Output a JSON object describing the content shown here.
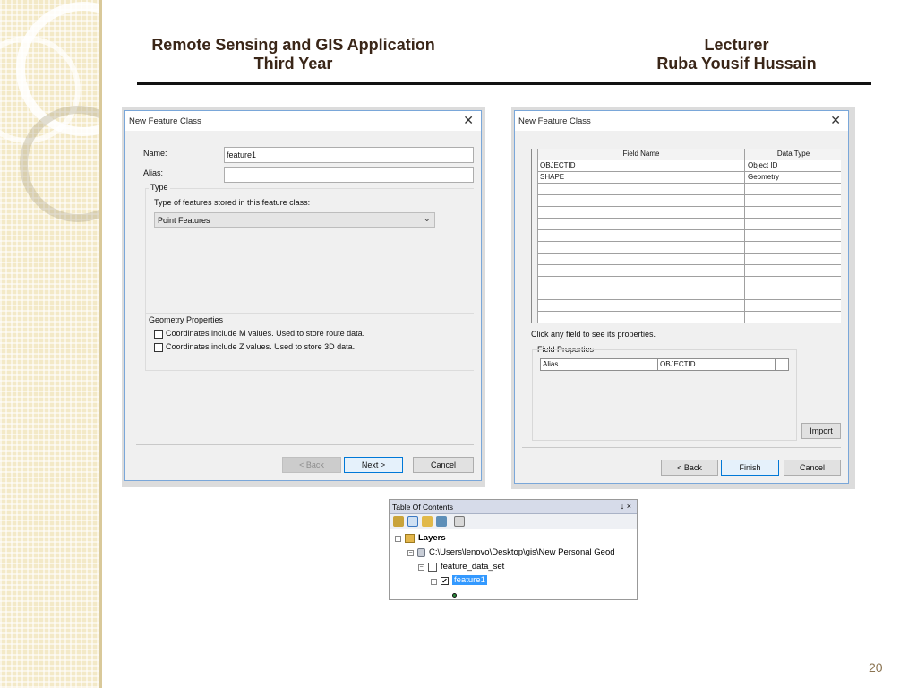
{
  "header": {
    "course_line1": "Remote Sensing and GIS Application",
    "course_line2": "Third Year",
    "role": "Lecturer",
    "lecturer_name": "Ruba Yousif Hussain"
  },
  "dialog1": {
    "title": "New Feature Class",
    "name_label": "Name:",
    "name_value": "feature1",
    "alias_label": "Alias:",
    "alias_value": "",
    "type_group": "Type",
    "type_prompt": "Type of features stored in this feature class:",
    "type_selected": "Point Features",
    "geometry_group": "Geometry Properties",
    "option_m": "Coordinates include M values. Used to store route data.",
    "option_z": "Coordinates include Z values. Used to store 3D data.",
    "back": "< Back",
    "next": "Next >",
    "cancel": "Cancel"
  },
  "dialog2": {
    "title": "New Feature Class",
    "columns": [
      "Field Name",
      "Data Type"
    ],
    "rows": [
      [
        "OBJECTID",
        "Object ID"
      ],
      [
        "SHAPE",
        "Geometry"
      ]
    ],
    "hint": "Click any field to see its properties.",
    "field_props_label": "Field Properties",
    "prop_key": "Alias",
    "prop_value": "OBJECTID",
    "import": "Import",
    "back": "< Back",
    "finish": "Finish",
    "cancel": "Cancel"
  },
  "toc": {
    "title": "Table Of Contents",
    "pin": "↓ ×",
    "layers": "Layers",
    "path": "C:\\Users\\lenovo\\Desktop\\gis\\New Personal Geod",
    "dataset": "feature_data_set",
    "feature": "feature1"
  },
  "page_number": "20"
}
